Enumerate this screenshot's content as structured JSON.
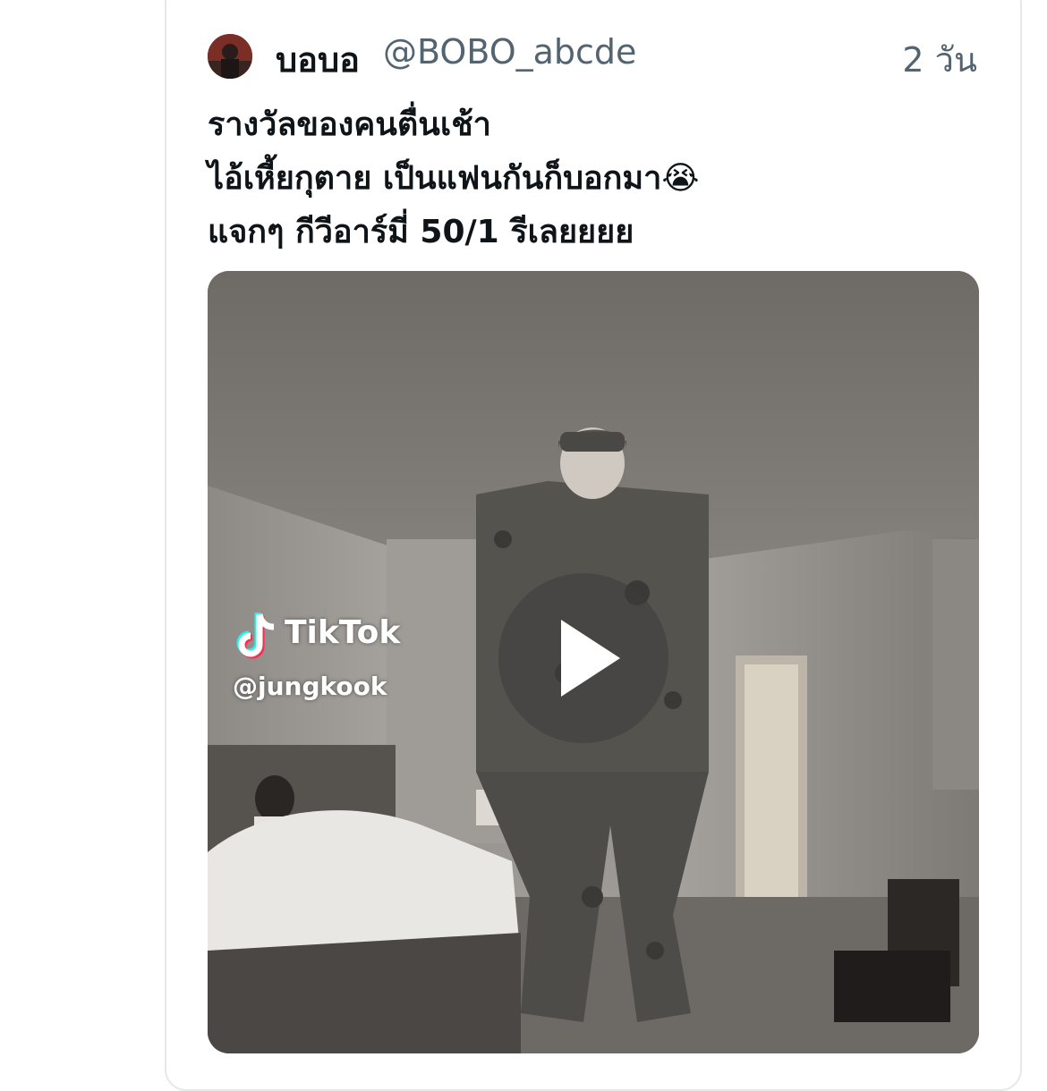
{
  "tweet": {
    "display_name": "บอบอ",
    "handle": "@BOBO_abcde",
    "time": "2 วัน",
    "text_lines": [
      "รางวัลของคนตื่นเช้า",
      "ไอ้เหี้ยกุตาย เป็นแฟนกันก็บอกมา😭",
      "แจกๆ กีวีอาร์มี่ 50/1 รีเลยยยย"
    ]
  },
  "media": {
    "type": "video",
    "watermark_brand": "TikTok",
    "watermark_handle": "@jungkook",
    "icons": [
      "tiktok-logo-icon",
      "play-icon"
    ]
  },
  "colors": {
    "primary_text": "#0f1419",
    "secondary_text": "#536471",
    "border": "#e6e8ea"
  }
}
